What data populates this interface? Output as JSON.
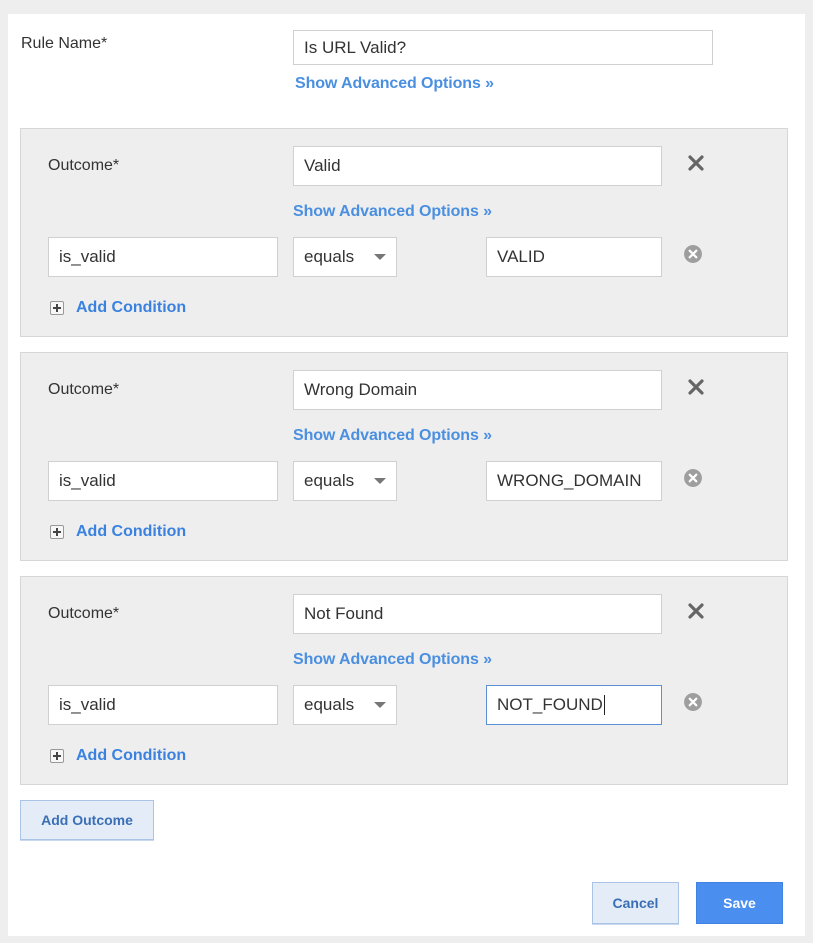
{
  "rule": {
    "name_label": "Rule Name*",
    "name_value": "Is URL Valid?",
    "advanced_link": "Show Advanced Options »"
  },
  "outcomes": [
    {
      "label": "Outcome*",
      "value": "Valid",
      "advanced_link": "Show Advanced Options »",
      "condition": {
        "field": "is_valid",
        "operator": "equals",
        "value": "VALID"
      },
      "add_condition": "Add Condition"
    },
    {
      "label": "Outcome*",
      "value": "Wrong Domain",
      "advanced_link": "Show Advanced Options »",
      "condition": {
        "field": "is_valid",
        "operator": "equals",
        "value": "WRONG_DOMAIN"
      },
      "add_condition": "Add Condition"
    },
    {
      "label": "Outcome*",
      "value": "Not Found",
      "advanced_link": "Show Advanced Options »",
      "condition": {
        "field": "is_valid",
        "operator": "equals",
        "value": "NOT_FOUND"
      },
      "add_condition": "Add Condition"
    }
  ],
  "actions": {
    "add_outcome": "Add Outcome",
    "cancel": "Cancel",
    "save": "Save"
  },
  "icons": {
    "remove_outcome": "close-x-icon",
    "remove_condition": "circle-close-icon",
    "add_condition": "plus-square-icon",
    "dropdown": "caret-down-icon"
  },
  "colors": {
    "link": "#4a8fe0",
    "primary": "#4a8ff0",
    "card_bg": "#eeeeee"
  }
}
